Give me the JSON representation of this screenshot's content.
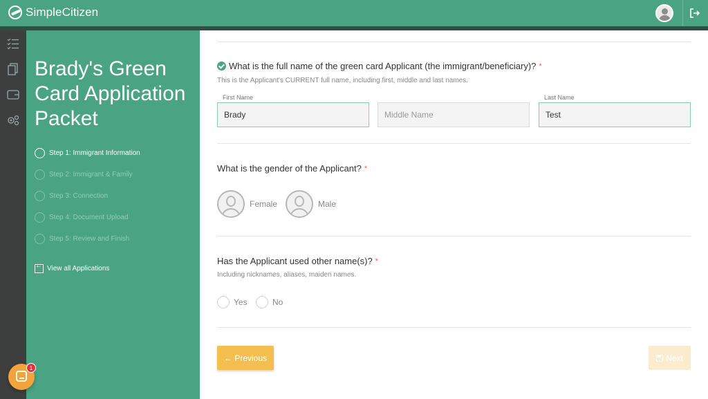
{
  "header": {
    "brand": "SimpleCitizen"
  },
  "sidebar": {
    "title": "Brady's Green Card Application Packet",
    "steps": [
      {
        "label": "Step 1: Immigrant Information",
        "active": true
      },
      {
        "label": "Step 2: Immigrant & Family",
        "active": false
      },
      {
        "label": "Step 3: Connection",
        "active": false
      },
      {
        "label": "Step 4: Document Upload",
        "active": false
      },
      {
        "label": "Step 5: Review and Finish",
        "active": false
      }
    ],
    "view_all": "View all Applications"
  },
  "form": {
    "name_question": {
      "title": "What is the full name of the green card Applicant (the immigrant/beneficiary)?",
      "required_mark": "*",
      "hint": "This is the Applicant's CURRENT full name, including first, middle and last names.",
      "first_name_label": "First Name",
      "first_name_value": "Brady",
      "middle_name_placeholder": "Middle Name",
      "middle_name_value": "",
      "last_name_label": "Last Name",
      "last_name_value": "Test"
    },
    "gender_question": {
      "title": "What is the gender of the Applicant?",
      "required_mark": "*",
      "options": [
        "Female",
        "Male"
      ]
    },
    "other_names_question": {
      "title": "Has the Applicant used other name(s)?",
      "required_mark": "*",
      "hint": "Including nicknames, aliases, maiden names.",
      "options": [
        "Yes",
        "No"
      ]
    },
    "previous_label": "← Previous",
    "next_label": "Next"
  },
  "chat": {
    "badge_count": "1"
  },
  "colors": {
    "brand_green": "#4aa383",
    "dark_rail": "#3d3f3f",
    "previous_button": "#f4bf4f",
    "required": "#e36b52"
  }
}
